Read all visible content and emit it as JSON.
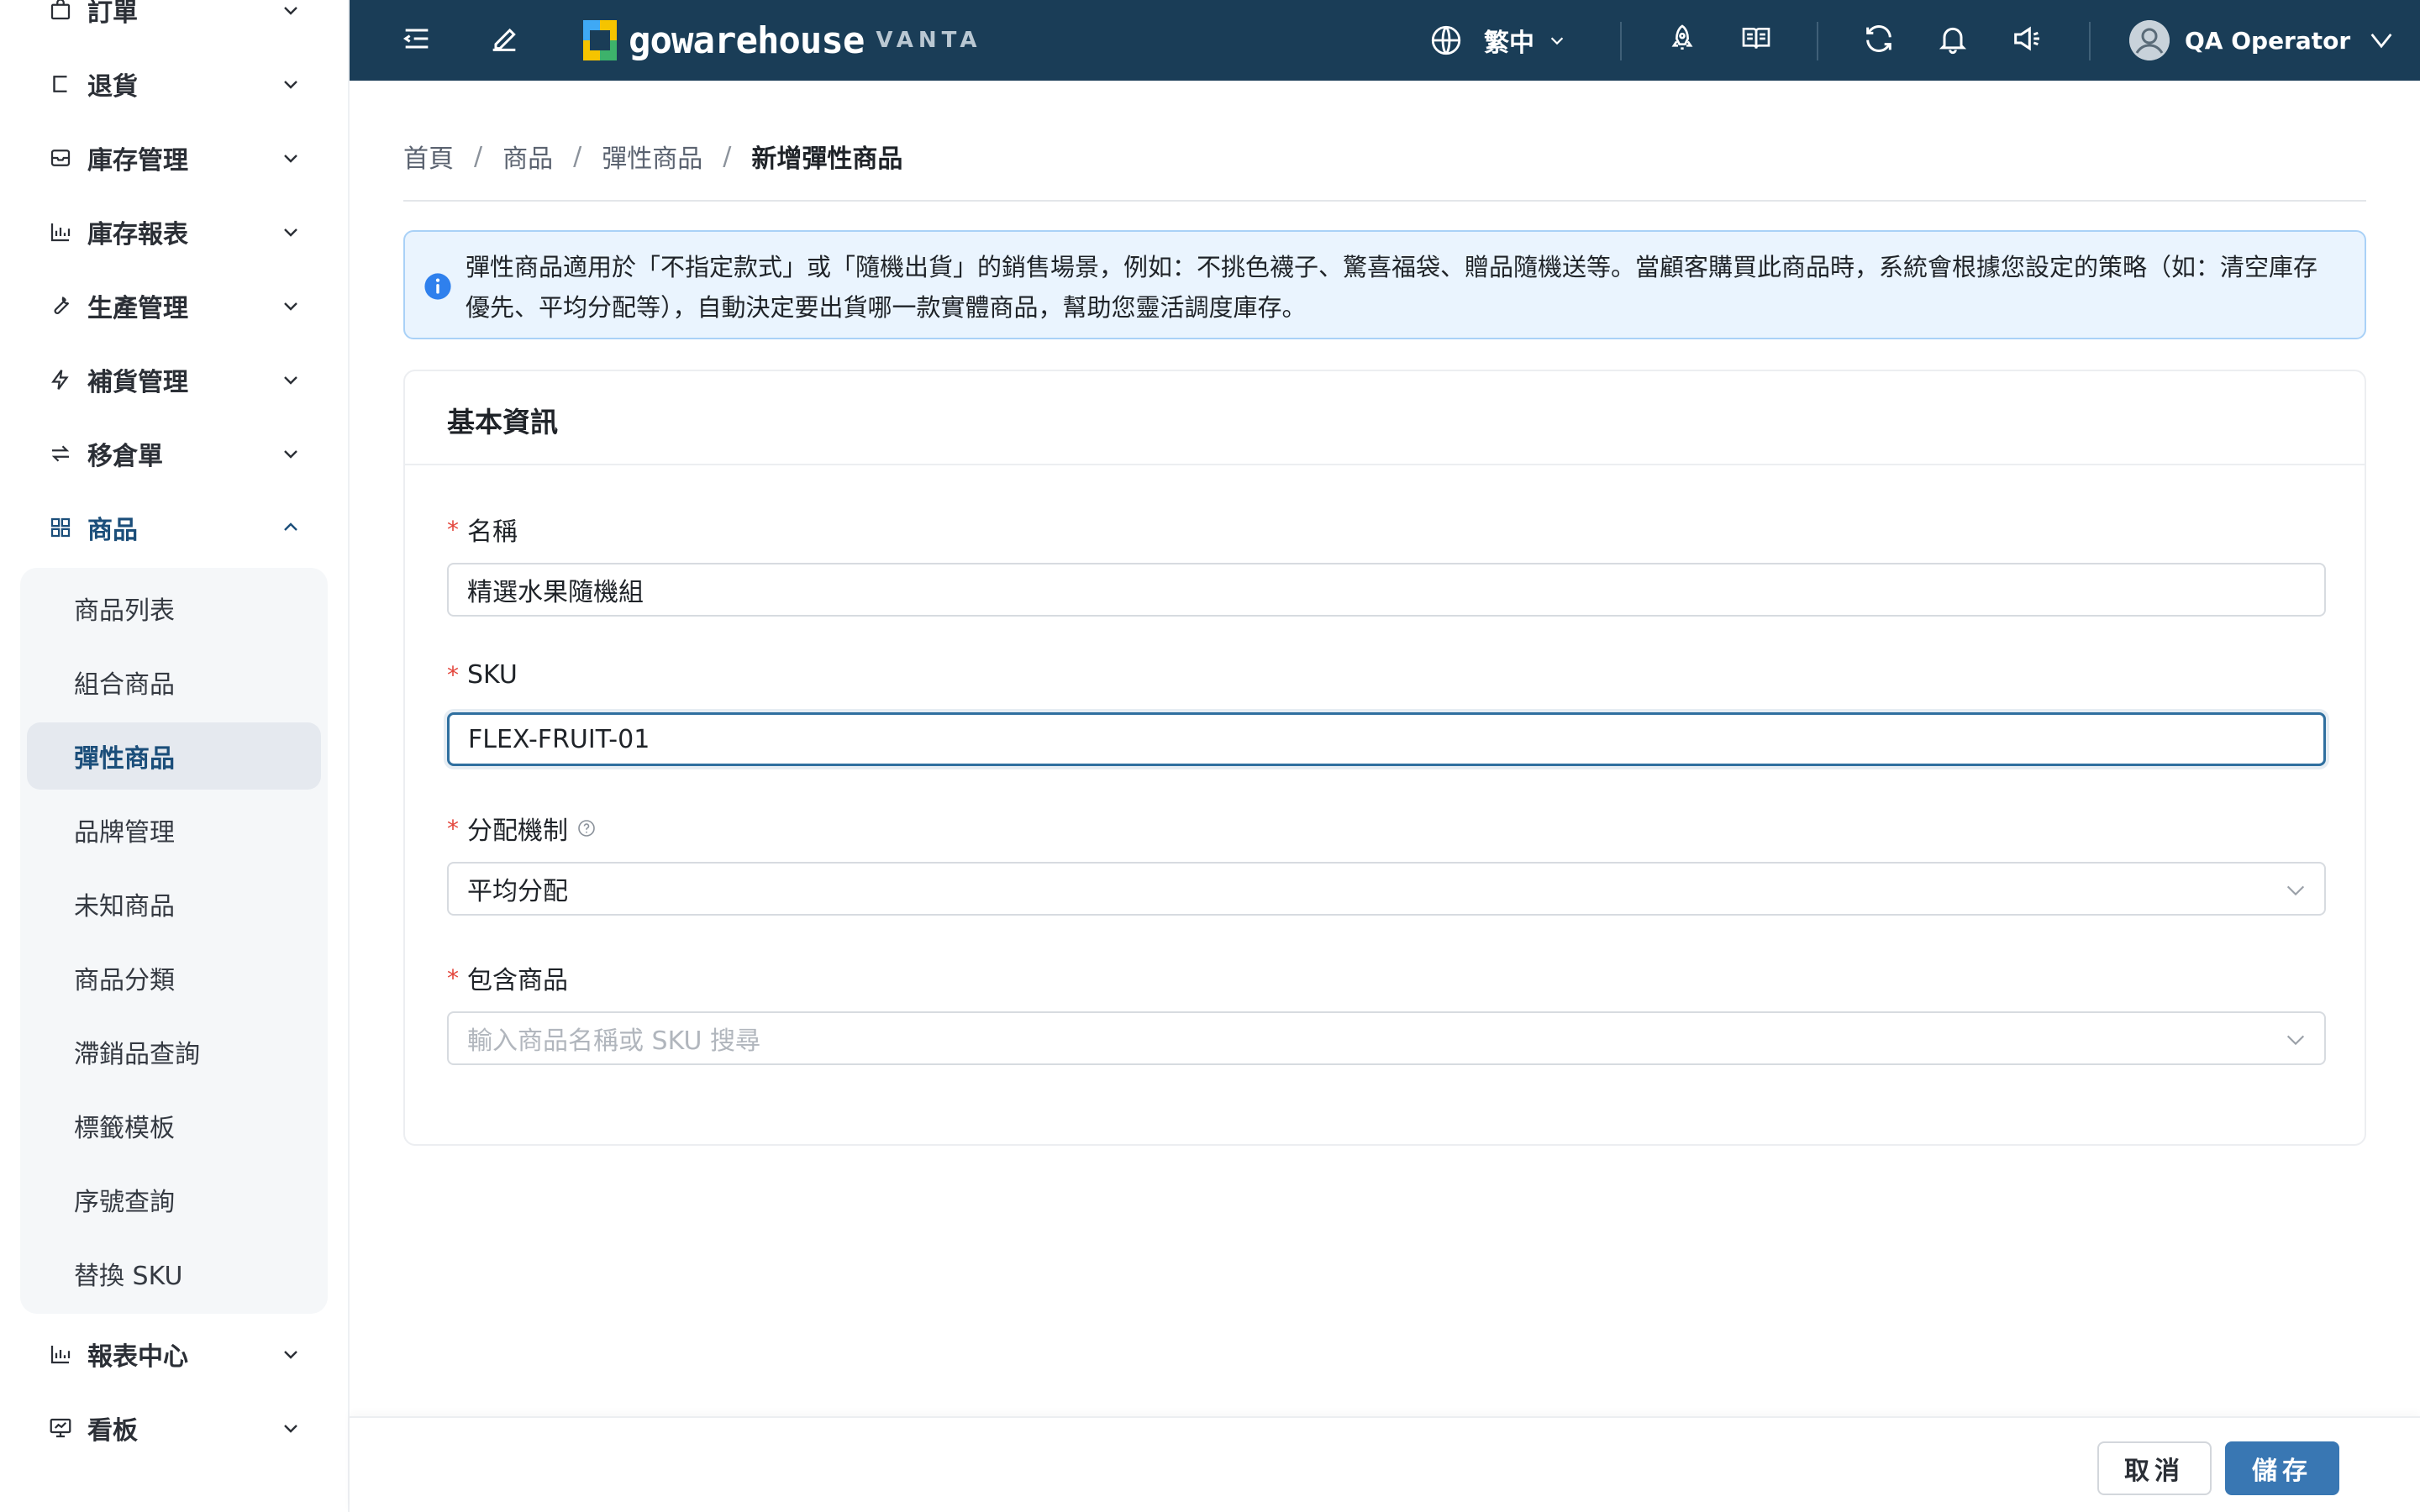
{
  "sidebar": {
    "items": [
      {
        "label": "訂單",
        "icon": "bag-icon",
        "expanded": false
      },
      {
        "label": "退貨",
        "icon": "return-icon",
        "expanded": false
      },
      {
        "label": "庫存管理",
        "icon": "inbox-icon",
        "expanded": false
      },
      {
        "label": "庫存報表",
        "icon": "bar-chart-icon",
        "expanded": false
      },
      {
        "label": "生產管理",
        "icon": "wrench-icon",
        "expanded": false
      },
      {
        "label": "補貨管理",
        "icon": "lightning-icon",
        "expanded": false
      },
      {
        "label": "移倉單",
        "icon": "swap-icon",
        "expanded": false
      },
      {
        "label": "商品",
        "icon": "grid-icon",
        "expanded": true
      },
      {
        "label": "報表中心",
        "icon": "bar-chart-icon",
        "expanded": false
      },
      {
        "label": "看板",
        "icon": "dashboard-icon",
        "expanded": false
      }
    ],
    "product_submenu": [
      {
        "label": "商品列表"
      },
      {
        "label": "組合商品"
      },
      {
        "label": "彈性商品",
        "selected": true
      },
      {
        "label": "品牌管理"
      },
      {
        "label": "未知商品"
      },
      {
        "label": "商品分類"
      },
      {
        "label": "滯銷品查詢"
      },
      {
        "label": "標籤模板"
      },
      {
        "label": "序號查詢"
      },
      {
        "label": "替換 SKU"
      }
    ]
  },
  "header": {
    "logo_text": "gowarehouse",
    "logo_sub": "VANTA",
    "language": "繁中",
    "user_name": "QA Operator",
    "bg_color": "#1a3d57"
  },
  "breadcrumb": [
    "首頁",
    "商品",
    "彈性商品",
    "新增彈性商品"
  ],
  "alert": {
    "text": "彈性商品適用於「不指定款式」或「隨機出貨」的銷售場景，例如：不挑色襪子、驚喜福袋、贈品隨機送等。當顧客購買此商品時，系統會根據您設定的策略（如：清空庫存優先、平均分配等），自動決定要出貨哪一款實體商品，幫助您靈活調度庫存。"
  },
  "form": {
    "section_title": "基本資訊",
    "name": {
      "label": "名稱",
      "value": "精選水果隨機組"
    },
    "sku": {
      "label": "SKU",
      "value": "FLEX-FRUIT-01"
    },
    "allocation": {
      "label": "分配機制",
      "value": "平均分配"
    },
    "products": {
      "label": "包含商品",
      "placeholder": "輸入商品名稱或 SKU 搜尋"
    }
  },
  "footer": {
    "cancel_label": "取消",
    "save_label": "儲存",
    "primary_color": "#3977b3"
  }
}
